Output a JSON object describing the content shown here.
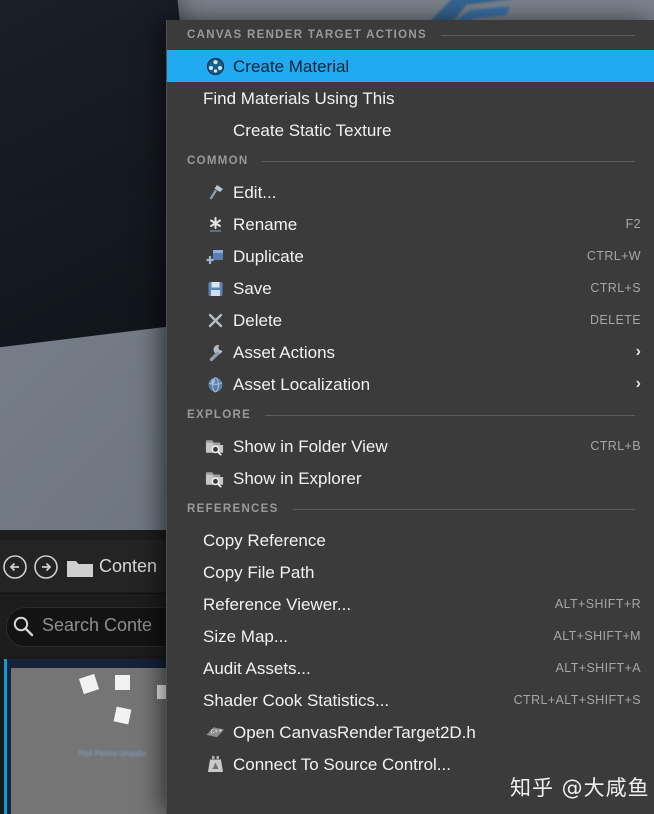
{
  "background": {
    "breadcrumb": "Conten",
    "search_placeholder": "Search Conte",
    "thumbnail_label": "Pod Pence Unsubs",
    "back_icon": "back-arrow-icon",
    "forward_icon": "forward-arrow-icon",
    "folder_icon": "folder-icon",
    "search_icon": "search-icon"
  },
  "menu": {
    "sections": [
      {
        "label": "CANVAS RENDER TARGET ACTIONS",
        "items": [
          {
            "label": "Create Material",
            "icon": "material-sphere-icon",
            "shortcut": "",
            "submenu": false,
            "selected": true
          },
          {
            "label": "Find Materials Using This",
            "icon": "",
            "shortcut": "",
            "submenu": false,
            "selected": false
          },
          {
            "label": "Create Static Texture",
            "icon": "checker-texture-icon",
            "shortcut": "",
            "submenu": false,
            "selected": false
          }
        ]
      },
      {
        "label": "COMMON",
        "items": [
          {
            "label": "Edit...",
            "icon": "hammer-icon",
            "shortcut": "",
            "submenu": false,
            "selected": false
          },
          {
            "label": "Rename",
            "icon": "rename-asterisk-icon",
            "shortcut": "F2",
            "submenu": false,
            "selected": false
          },
          {
            "label": "Duplicate",
            "icon": "duplicate-icon",
            "shortcut": "CTRL+W",
            "submenu": false,
            "selected": false
          },
          {
            "label": "Save",
            "icon": "save-floppy-icon",
            "shortcut": "CTRL+S",
            "submenu": false,
            "selected": false
          },
          {
            "label": "Delete",
            "icon": "delete-x-icon",
            "shortcut": "DELETE",
            "submenu": false,
            "selected": false
          },
          {
            "label": "Asset Actions",
            "icon": "wrench-icon",
            "shortcut": "",
            "submenu": true,
            "selected": false
          },
          {
            "label": "Asset Localization",
            "icon": "globe-icon",
            "shortcut": "",
            "submenu": true,
            "selected": false
          }
        ]
      },
      {
        "label": "EXPLORE",
        "items": [
          {
            "label": "Show in Folder View",
            "icon": "folder-search-icon",
            "shortcut": "CTRL+B",
            "submenu": false,
            "selected": false
          },
          {
            "label": "Show in Explorer",
            "icon": "folder-search-icon",
            "shortcut": "",
            "submenu": false,
            "selected": false
          }
        ]
      },
      {
        "label": "REFERENCES",
        "items": [
          {
            "label": "Copy Reference",
            "icon": "",
            "shortcut": "",
            "submenu": false,
            "selected": false
          },
          {
            "label": "Copy File Path",
            "icon": "",
            "shortcut": "",
            "submenu": false,
            "selected": false
          },
          {
            "label": "Reference Viewer...",
            "icon": "",
            "shortcut": "ALT+SHIFT+R",
            "submenu": false,
            "selected": false
          },
          {
            "label": "Size Map...",
            "icon": "",
            "shortcut": "ALT+SHIFT+M",
            "submenu": false,
            "selected": false
          },
          {
            "label": "Audit Assets...",
            "icon": "",
            "shortcut": "ALT+SHIFT+A",
            "submenu": false,
            "selected": false
          },
          {
            "label": "Shader Cook Statistics...",
            "icon": "",
            "shortcut": "CTRL+ALT+SHIFT+S",
            "submenu": false,
            "selected": false
          },
          {
            "label": "Open CanvasRenderTarget2D.h",
            "icon": "cpp-file-icon",
            "shortcut": "",
            "submenu": false,
            "selected": false
          },
          {
            "label": "Connect To Source Control...",
            "icon": "source-control-icon",
            "shortcut": "",
            "submenu": false,
            "selected": false
          }
        ]
      }
    ],
    "submenu_glyph": "›"
  },
  "watermark": {
    "text": "知乎 @大咸鱼"
  },
  "colors": {
    "menu_bg": "#3b3b3b",
    "highlight": "#22aaf0",
    "highlight_text": "#0d2235",
    "item_text": "#f2f2f2",
    "section_text": "#9a9a9a",
    "shortcut_text": "#a6a6a6",
    "rule": "#5d5d5d"
  }
}
